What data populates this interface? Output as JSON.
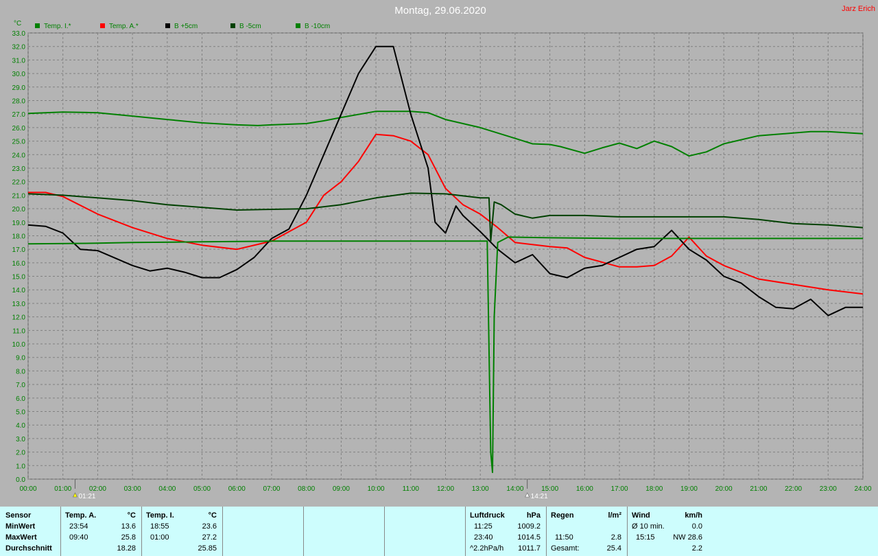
{
  "title": "Montag, 29.06.2020",
  "author": "Jarz Erich",
  "colors": {
    "background": "#b4b4b4",
    "grid": "#808080",
    "axis_text": "#008000",
    "title": "#ffffff",
    "author": "#ff0000",
    "table_bg": "#cdfdfd"
  },
  "chart_data": {
    "type": "line",
    "ylabel": "°C",
    "ylim": [
      0,
      33
    ],
    "y_tick_labels": [
      "0.0",
      "1.0",
      "2.0",
      "3.0",
      "4.0",
      "5.0",
      "6.0",
      "7.0",
      "8.0",
      "9.0",
      "10.0",
      "11.0",
      "12.0",
      "13.0",
      "14.0",
      "15.0",
      "16.0",
      "17.0",
      "18.0",
      "19.0",
      "20.0",
      "21.0",
      "22.0",
      "23.0",
      "24.0",
      "25.0",
      "26.0",
      "27.0",
      "28.0",
      "29.0",
      "30.0",
      "31.0",
      "32.0",
      "33.0"
    ],
    "xlim": [
      0,
      24
    ],
    "x_tick_labels": [
      "00:00",
      "01:00",
      "02:00",
      "03:00",
      "04:00",
      "05:00",
      "06:00",
      "07:00",
      "08:00",
      "09:00",
      "10:00",
      "11:00",
      "12:00",
      "13:00",
      "14:00",
      "15:00",
      "16:00",
      "17:00",
      "18:00",
      "19:00",
      "20:00",
      "21:00",
      "22:00",
      "23:00",
      "24:00"
    ],
    "grid": true,
    "legend_position": "top-left",
    "markers": [
      {
        "label": "01:21",
        "x": 1.35,
        "icon": "sunrise-icon"
      },
      {
        "label": "14:21",
        "x": 14.35,
        "icon": "sunset-icon"
      }
    ],
    "series": [
      {
        "name": "Temp. I.*",
        "color": "#008000",
        "points": [
          [
            0,
            27.05
          ],
          [
            1,
            27.15
          ],
          [
            2,
            27.1
          ],
          [
            3,
            26.85
          ],
          [
            4,
            26.6
          ],
          [
            5,
            26.35
          ],
          [
            6,
            26.2
          ],
          [
            6.6,
            26.15
          ],
          [
            7,
            26.2
          ],
          [
            8,
            26.3
          ],
          [
            8.5,
            26.5
          ],
          [
            9,
            26.75
          ],
          [
            10,
            27.2
          ],
          [
            11,
            27.2
          ],
          [
            11.5,
            27.1
          ],
          [
            12,
            26.6
          ],
          [
            13,
            26
          ],
          [
            14,
            25.2
          ],
          [
            14.5,
            24.8
          ],
          [
            15,
            24.75
          ],
          [
            15.3,
            24.6
          ],
          [
            16,
            24.1
          ],
          [
            16.5,
            24.5
          ],
          [
            17,
            24.85
          ],
          [
            17.5,
            24.45
          ],
          [
            18,
            25
          ],
          [
            18.5,
            24.6
          ],
          [
            19,
            23.9
          ],
          [
            19.5,
            24.2
          ],
          [
            20,
            24.8
          ],
          [
            21,
            25.4
          ],
          [
            22,
            25.6
          ],
          [
            22.5,
            25.7
          ],
          [
            23,
            25.7
          ],
          [
            24,
            25.55
          ]
        ]
      },
      {
        "name": "Temp. A.*",
        "color": "#ff0000",
        "points": [
          [
            0,
            21.2
          ],
          [
            0.5,
            21.2
          ],
          [
            1,
            20.9
          ],
          [
            2,
            19.6
          ],
          [
            3,
            18.6
          ],
          [
            4,
            17.8
          ],
          [
            5,
            17.3
          ],
          [
            6,
            17
          ],
          [
            7,
            17.6
          ],
          [
            8,
            19
          ],
          [
            8.5,
            21
          ],
          [
            9,
            22
          ],
          [
            9.5,
            23.5
          ],
          [
            10,
            25.5
          ],
          [
            10.5,
            25.4
          ],
          [
            11,
            25
          ],
          [
            11.5,
            24
          ],
          [
            12,
            21.5
          ],
          [
            12.5,
            20.3
          ],
          [
            13,
            19.6
          ],
          [
            13.5,
            18.6
          ],
          [
            14,
            17.5
          ],
          [
            15,
            17.2
          ],
          [
            15.5,
            17.1
          ],
          [
            16,
            16.4
          ],
          [
            17,
            15.7
          ],
          [
            17.5,
            15.7
          ],
          [
            18,
            15.8
          ],
          [
            18.5,
            16.5
          ],
          [
            19,
            17.9
          ],
          [
            19.5,
            16.5
          ],
          [
            20,
            15.8
          ],
          [
            21,
            14.8
          ],
          [
            22,
            14.4
          ],
          [
            23,
            14
          ],
          [
            24,
            13.7
          ]
        ]
      },
      {
        "name": "B +5cm",
        "color": "#000000",
        "points": [
          [
            0,
            18.8
          ],
          [
            0.5,
            18.7
          ],
          [
            1,
            18.2
          ],
          [
            1.5,
            17
          ],
          [
            2,
            16.9
          ],
          [
            3,
            15.8
          ],
          [
            3.5,
            15.4
          ],
          [
            4,
            15.6
          ],
          [
            4.5,
            15.3
          ],
          [
            5,
            14.9
          ],
          [
            5.5,
            14.9
          ],
          [
            6,
            15.5
          ],
          [
            6.5,
            16.4
          ],
          [
            7,
            17.8
          ],
          [
            7.5,
            18.5
          ],
          [
            8,
            21
          ],
          [
            8.5,
            24
          ],
          [
            9,
            27
          ],
          [
            9.5,
            30
          ],
          [
            10,
            32
          ],
          [
            10.5,
            32
          ],
          [
            11,
            27
          ],
          [
            11.5,
            23
          ],
          [
            11.7,
            19
          ],
          [
            12,
            18.2
          ],
          [
            12.3,
            20.2
          ],
          [
            12.5,
            19.5
          ],
          [
            13,
            18.3
          ],
          [
            13.5,
            17
          ],
          [
            14,
            16
          ],
          [
            14.5,
            16.6
          ],
          [
            15,
            15.2
          ],
          [
            15.5,
            14.9
          ],
          [
            16,
            15.6
          ],
          [
            16.5,
            15.8
          ],
          [
            17,
            16.4
          ],
          [
            17.5,
            17
          ],
          [
            18,
            17.2
          ],
          [
            18.5,
            18.4
          ],
          [
            19,
            17
          ],
          [
            19.5,
            16.2
          ],
          [
            20,
            15
          ],
          [
            20.5,
            14.5
          ],
          [
            21,
            13.5
          ],
          [
            21.5,
            12.7
          ],
          [
            22,
            12.6
          ],
          [
            22.5,
            13.3
          ],
          [
            23,
            12.1
          ],
          [
            23.5,
            12.7
          ],
          [
            24,
            12.7
          ]
        ]
      },
      {
        "name": "B -5cm",
        "color": "#004000",
        "points": [
          [
            0,
            21.1
          ],
          [
            1,
            21
          ],
          [
            2,
            20.8
          ],
          [
            3,
            20.6
          ],
          [
            4,
            20.3
          ],
          [
            5,
            20.1
          ],
          [
            6,
            19.9
          ],
          [
            7,
            19.95
          ],
          [
            8,
            20
          ],
          [
            9,
            20.3
          ],
          [
            10,
            20.8
          ],
          [
            11,
            21.15
          ],
          [
            12,
            21.1
          ],
          [
            13,
            20.8
          ],
          [
            13.25,
            20.8
          ],
          [
            13.3,
            17.6
          ],
          [
            13.4,
            20.5
          ],
          [
            13.6,
            20.3
          ],
          [
            14,
            19.6
          ],
          [
            14.5,
            19.3
          ],
          [
            15,
            19.5
          ],
          [
            16,
            19.5
          ],
          [
            17,
            19.4
          ],
          [
            18,
            19.4
          ],
          [
            19,
            19.4
          ],
          [
            20,
            19.4
          ],
          [
            21,
            19.2
          ],
          [
            22,
            18.9
          ],
          [
            23,
            18.8
          ],
          [
            24,
            18.6
          ]
        ]
      },
      {
        "name": "B -10cm",
        "color": "#008000",
        "points": [
          [
            0,
            17.4
          ],
          [
            2,
            17.45
          ],
          [
            3,
            17.5
          ],
          [
            5,
            17.55
          ],
          [
            7,
            17.6
          ],
          [
            9,
            17.6
          ],
          [
            11,
            17.6
          ],
          [
            13,
            17.6
          ],
          [
            13.2,
            17.6
          ],
          [
            13.3,
            2
          ],
          [
            13.35,
            0.5
          ],
          [
            13.4,
            12
          ],
          [
            13.5,
            17.5
          ],
          [
            13.8,
            17.9
          ],
          [
            15,
            17.85
          ],
          [
            17,
            17.8
          ],
          [
            20,
            17.8
          ],
          [
            24,
            17.8
          ]
        ]
      }
    ]
  },
  "table": {
    "rows": [
      "Sensor",
      "MinWert",
      "MaxWert",
      "Durchschnitt"
    ],
    "temp_a": {
      "header": "Temp. A.",
      "unit": "°C",
      "min_time": "23:54",
      "min_val": "13.6",
      "max_time": "09:40",
      "max_val": "25.8",
      "avg": "18.28"
    },
    "temp_i": {
      "header": "Temp. I.",
      "unit": "°C",
      "min_time": "18:55",
      "min_val": "23.6",
      "max_time": "01:00",
      "max_val": "27.2",
      "avg": "25.85"
    },
    "pressure": {
      "header": "Luftdruck",
      "unit": "hPa",
      "min_time": "11:25",
      "min_val": "1009.2",
      "max_time": "23:40",
      "max_val": "1014.5",
      "trend_label": "^2.2hPa/h",
      "trend_val": "1011.7"
    },
    "rain": {
      "header": "Regen",
      "unit": "l/m²",
      "time": "11:50",
      "val": "2.8",
      "total_label": "Gesamt:",
      "total_val": "25.4"
    },
    "wind": {
      "header": "Wind",
      "unit": "km/h",
      "avg_label": "Ø 10 min.",
      "avg_val": "0.0",
      "gust_time": "15:15",
      "gust_val": "NW 28.6",
      "cur_val": "2.2"
    }
  }
}
